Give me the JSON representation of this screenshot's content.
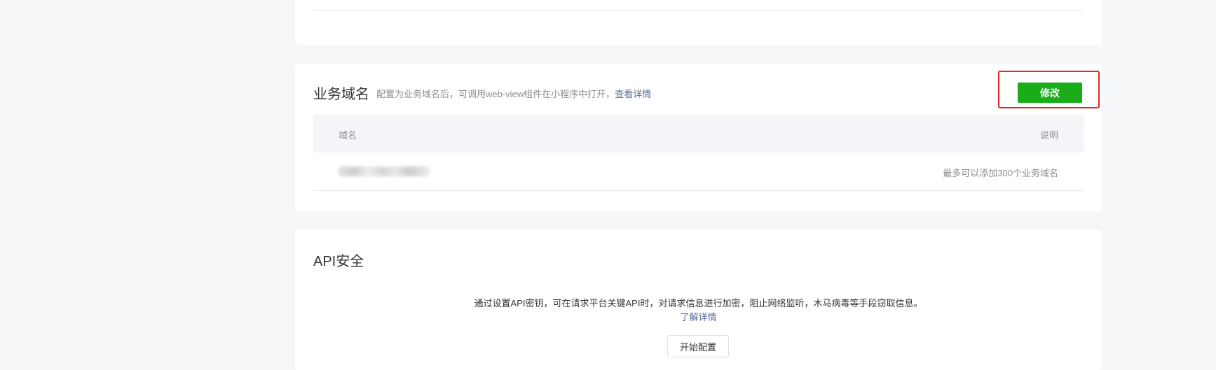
{
  "business_domain": {
    "title": "业务域名",
    "description": "配置为业务域名后，可调用web-view组件在小程序中打开，",
    "details_link": "查看详情",
    "modify_button": "修改",
    "table": {
      "headers": [
        "域名",
        "说明"
      ],
      "rows": [
        {
          "domain": "",
          "note": "最多可以添加300个业务域名"
        }
      ]
    }
  },
  "api_security": {
    "title": "API安全",
    "description": "通过设置API密钥，可在请求平台关键API时，对请求信息进行加密，阻止网络监听，木马病毒等手段窃取信息。",
    "learn_more": "了解详情",
    "start_button": "开始配置"
  },
  "colors": {
    "primary_button": "#1aad19",
    "link": "#576b95",
    "highlight_border": "#e5281f"
  }
}
